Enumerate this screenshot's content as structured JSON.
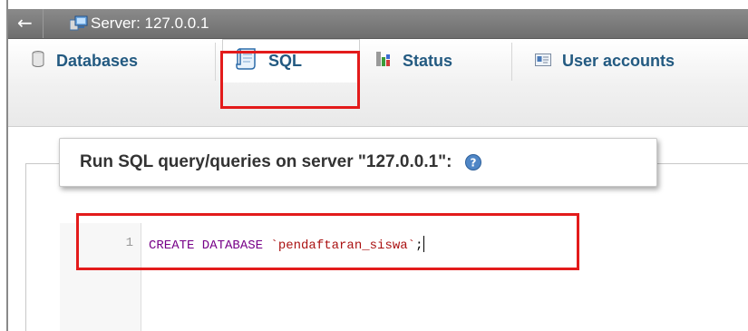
{
  "breadcrumb": {
    "server_label": "Server: 127.0.0.1"
  },
  "tabs": [
    {
      "label": "Databases",
      "icon": "database-icon"
    },
    {
      "label": "SQL",
      "icon": "sql-scroll-icon",
      "active": true
    },
    {
      "label": "Status",
      "icon": "status-chart-icon"
    },
    {
      "label": "User accounts",
      "icon": "user-accounts-icon"
    }
  ],
  "query_panel": {
    "legend": "Run SQL query/queries on server \"127.0.0.1\":",
    "help_icon": "help-icon"
  },
  "editor": {
    "line_number": "1",
    "code": {
      "keyword": "CREATE DATABASE ",
      "identifier": "`pendaftaran_siswa`",
      "terminator": ";"
    }
  },
  "colors": {
    "tab_text": "#235a81",
    "highlight": "#e31b1b",
    "keyword": "#770088",
    "string": "#aa1111"
  }
}
